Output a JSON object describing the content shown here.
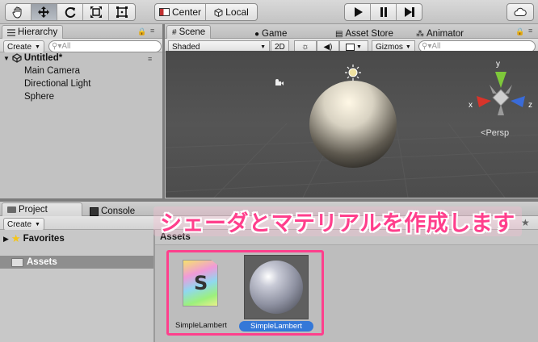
{
  "toolbar": {
    "tools": [
      "hand-tool",
      "move-tool",
      "rotate-tool",
      "scale-tool",
      "rect-tool"
    ],
    "pivot_label": "Center",
    "space_label": "Local",
    "play_controls": [
      "play",
      "pause",
      "step"
    ]
  },
  "hierarchy": {
    "tab_label": "Hierarchy",
    "create_label": "Create",
    "search_placeholder": "All",
    "scene_name": "Untitled*",
    "items": [
      "Main Camera",
      "Directional Light",
      "Sphere"
    ]
  },
  "scene_view": {
    "tabs": [
      "Scene",
      "Game",
      "Asset Store",
      "Animator"
    ],
    "shading_mode": "Shaded",
    "mode_2d": "2D",
    "gizmos_label": "Gizmos",
    "search_placeholder": "All",
    "projection_label": "Persp",
    "axis_labels": {
      "x": "x",
      "y": "y",
      "z": "z"
    },
    "axis_colors": {
      "x": "#d8342a",
      "y": "#7ec83a",
      "z": "#3a6bd8"
    }
  },
  "project": {
    "tabs": [
      "Project",
      "Console"
    ],
    "create_label": "Create",
    "favorites_label": "Favorites",
    "assets_folder_label": "Assets",
    "breadcrumb": "Assets",
    "assets": [
      {
        "name": "SimpleLambert",
        "type": "shader",
        "icon_letter": "S",
        "selected": false
      },
      {
        "name": "SimpleLambert",
        "type": "material",
        "selected": true
      }
    ]
  },
  "annotation": {
    "text": "シェーダとマテリアルを作成します",
    "color": "#ff3f8c"
  }
}
